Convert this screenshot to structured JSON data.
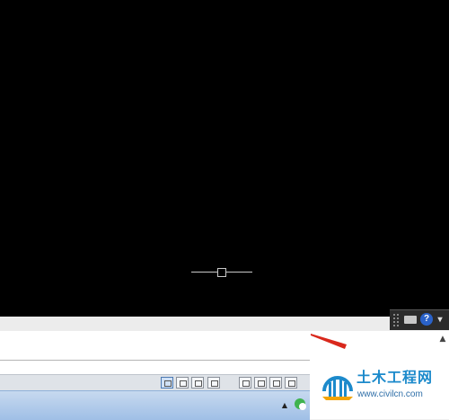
{
  "help_icon": {
    "glyph": "?"
  },
  "ribbon_dropdown": {
    "glyph": "▾"
  },
  "command_scroll": {
    "glyph": "▲"
  },
  "tray": {
    "expand_glyph": "▲"
  },
  "watermark": {
    "title": "土木工程网",
    "url": "www.civilcn.com"
  },
  "colors": {
    "canvas": "#000000",
    "annotation_arrow": "#d9281c",
    "watermark_blue": "#1c8acb"
  }
}
